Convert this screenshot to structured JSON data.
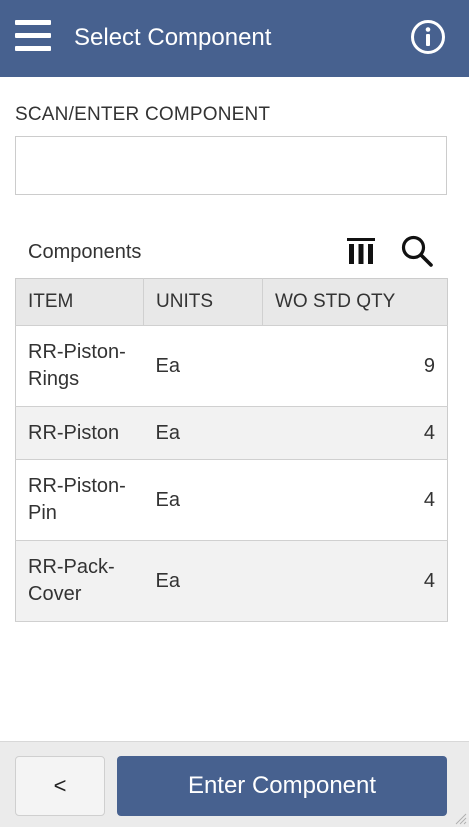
{
  "header": {
    "title": "Select Component",
    "menu_icon": "hamburger-menu-icon",
    "info_icon": "info-circle-icon"
  },
  "scan": {
    "label": "SCAN/ENTER COMPONENT",
    "value": "",
    "placeholder": ""
  },
  "grid": {
    "title": "Components",
    "columns_icon": "columns-icon",
    "search_icon": "search-icon",
    "headers": [
      "ITEM",
      "UNITS",
      "WO STD QTY"
    ],
    "rows": [
      {
        "item": "RR-Piston-Rings",
        "units": "Ea",
        "qty": "9"
      },
      {
        "item": "RR-Piston",
        "units": "Ea",
        "qty": "4"
      },
      {
        "item": "RR-Piston-Pin",
        "units": "Ea",
        "qty": "4"
      },
      {
        "item": "RR-Pack-Cover",
        "units": "Ea",
        "qty": "4"
      }
    ]
  },
  "footer": {
    "back_label": "<",
    "enter_label": "Enter Component"
  },
  "colors": {
    "primary": "#47618f",
    "header_row": "#e8e8e8",
    "alt_row": "#f2f2f2",
    "footer_bg": "#ebebeb"
  }
}
